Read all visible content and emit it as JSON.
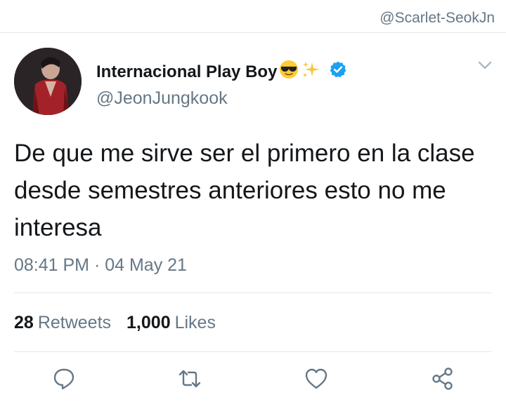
{
  "watermark": "@Scarlet-SeokJn",
  "tweet": {
    "display_name": "Internacional Play Boy",
    "handle": "@JeonJungkook",
    "text": "De que me sirve ser el primero en la clase desde semestres anteriores esto no me interesa",
    "timestamp": "08:41 PM · 04 May 21",
    "retweets_count": "28",
    "retweets_label": "Retweets",
    "likes_count": "1,000",
    "likes_label": "Likes"
  },
  "icons": {
    "name_emojis": [
      "sunglasses-emoji-icon",
      "sparkles-emoji-icon"
    ],
    "verified": "verified-badge-icon",
    "menu": "chevron-down-icon",
    "actions": [
      "reply-icon",
      "retweet-icon",
      "like-icon",
      "share-icon"
    ]
  },
  "colors": {
    "text": "#14171a",
    "secondary": "#657786",
    "divider": "#e1e8ed",
    "verified": "#1da1f2",
    "icon": "#657786"
  }
}
